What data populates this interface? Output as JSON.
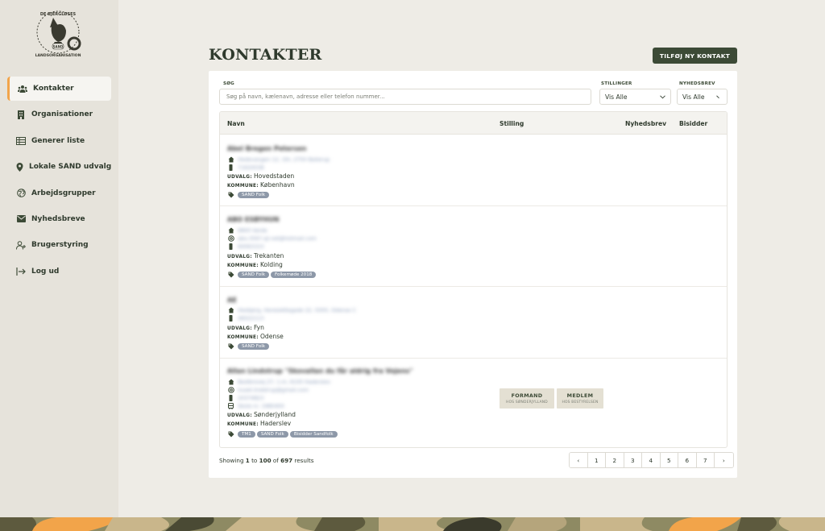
{
  "logo": {
    "text_top": "DE BJERGLØSES",
    "text_left": "LANDSORGANISATION",
    "badge": "SAND"
  },
  "sidebar": {
    "items": [
      {
        "label": "Kontakter",
        "icon": "users-icon",
        "active": true
      },
      {
        "label": "Organisationer",
        "icon": "building-icon",
        "active": false
      },
      {
        "label": "Generer liste",
        "icon": "table-icon",
        "active": false
      },
      {
        "label": "Lokale SAND udvalg",
        "icon": "map-pin-icon",
        "active": false
      },
      {
        "label": "Arbejdsgrupper",
        "icon": "globe-icon",
        "active": false
      },
      {
        "label": "Nyhedsbreve",
        "icon": "envelope-icon",
        "active": false
      },
      {
        "label": "Brugerstyring",
        "icon": "user-plus-icon",
        "active": false
      },
      {
        "label": "Log ud",
        "icon": "logout-icon",
        "active": false
      }
    ]
  },
  "page": {
    "title": "KONTAKTER",
    "add_button": "TILFØJ NY KONTAKT"
  },
  "filters": {
    "search_label": "SØG",
    "search_placeholder": "Søg på navn, kælenavn, adresse eller telefon nummer...",
    "positions_label": "STILLINGER",
    "positions_value": "Vis Alle",
    "newsletter_label": "NYHEDSBREV",
    "newsletter_value": "Vis Alle"
  },
  "table": {
    "headers": {
      "name": "Navn",
      "position": "Stilling",
      "newsletter": "Nyhedsbrev",
      "bisidder": "Bisidder"
    },
    "udvalg_key": "UDVALG:",
    "kommune_key": "KOMMUNE:",
    "rows": [
      {
        "name": "Abel Bregen Petersen",
        "address": "Hedevangen 12, 1th, 2750 Ballerup",
        "email": "",
        "phone": "71620038",
        "extra": "",
        "udvalg": "Hovedstaden",
        "kommune": "København",
        "tags": [
          "SAND Folk"
        ],
        "positions": []
      },
      {
        "name": "ABO ESBYHUN",
        "address": "6800 Varde",
        "email": "abo.3597.sjl.net@hotmail.com",
        "phone": "60063153",
        "extra": "",
        "udvalg": "Trekanten",
        "kommune": "Kolding",
        "tags": [
          "SAND Folk",
          "Folkemøde 2018"
        ],
        "positions": []
      },
      {
        "name": "AE",
        "address": "Hesbjerg, Hereslettegade 22, 5000, Odense C",
        "email": "",
        "phone": "46022113",
        "extra": "",
        "udvalg": "Fyn",
        "kommune": "Odense",
        "tags": [
          "SAND Folk"
        ],
        "positions": []
      },
      {
        "name": "Allan Lindstrup \"Skovallan du får aldrig fra Vojens\"",
        "address": "Bestbrovej 27, 1.m, 6100 Haderslev",
        "email": "huset.lindstrup@gmail.com",
        "phone": "20374823",
        "extra": "Skole nr. 1980400",
        "udvalg": "Sønderjylland",
        "kommune": "Haderslev",
        "tags": [
          "TM1",
          "SAND Folk",
          "Bisidder Sandfolk"
        ],
        "positions": [
          {
            "title": "FORMAND",
            "sub": "HOS SØNDERJYLLAND"
          },
          {
            "title": "MEDLEM",
            "sub": "HOS BESTYRELSEN"
          }
        ]
      }
    ]
  },
  "footer": {
    "results_prefix": "Showing ",
    "results_from": "1",
    "results_mid1": " to ",
    "results_to": "100",
    "results_mid2": " of ",
    "results_total": "697",
    "results_suffix": " results",
    "pages": [
      "1",
      "2",
      "3",
      "4",
      "5",
      "6",
      "7"
    ],
    "prev": "‹",
    "next": "›"
  },
  "colors": {
    "accent": "#f2a44a",
    "primary": "#3c4a36",
    "tag": "#8d98a8",
    "background": "#eeece6"
  }
}
